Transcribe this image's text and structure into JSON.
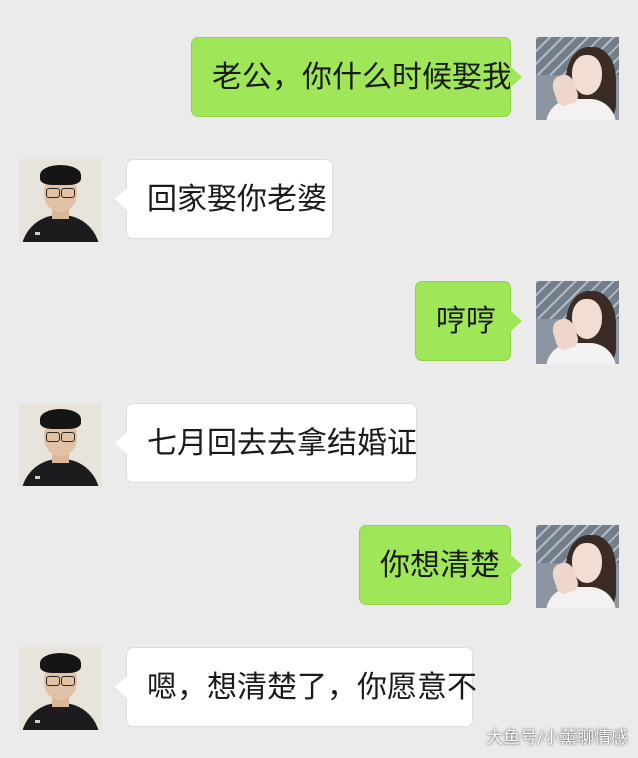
{
  "messages": [
    {
      "side": "right",
      "sender": "wife",
      "text": "老公，你什么时候娶我"
    },
    {
      "side": "left",
      "sender": "husband",
      "text": "回家娶你老婆"
    },
    {
      "side": "right",
      "sender": "wife",
      "text": "哼哼"
    },
    {
      "side": "left",
      "sender": "husband",
      "text": "七月回去去拿结婚证"
    },
    {
      "side": "right",
      "sender": "wife",
      "text": "你想清楚"
    },
    {
      "side": "left",
      "sender": "husband",
      "text": "嗯，想清楚了，你愿意不"
    }
  ],
  "watermark": "大鱼号/小薰聊情感",
  "colors": {
    "background": "#ebebeb",
    "sent_bubble": "#9fe658",
    "received_bubble": "#ffffff",
    "text": "#1a1a1a"
  }
}
